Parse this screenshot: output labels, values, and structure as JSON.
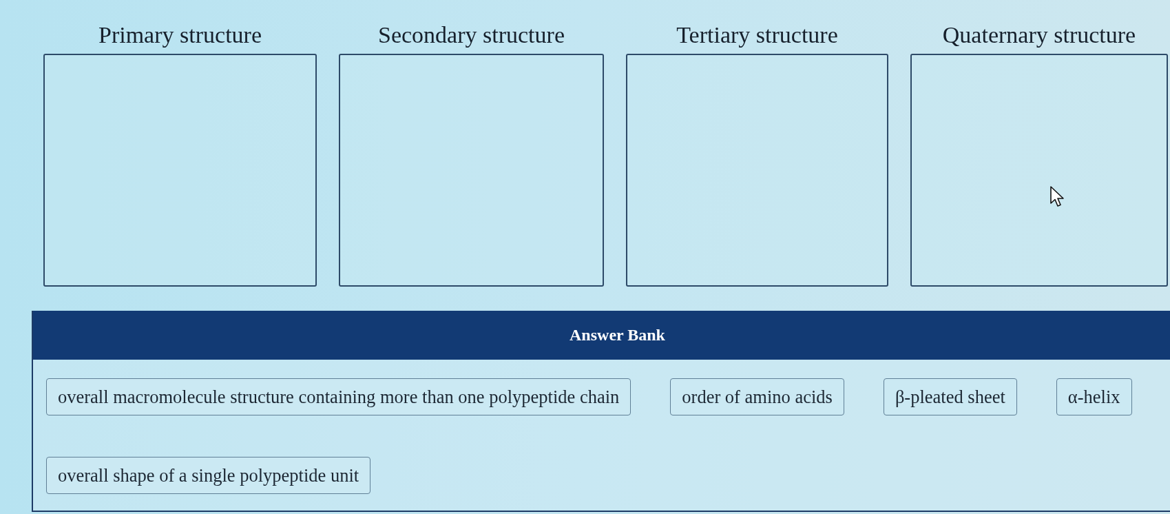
{
  "zones": [
    {
      "label": "Primary structure"
    },
    {
      "label": "Secondary structure"
    },
    {
      "label": "Tertiary structure"
    },
    {
      "label": "Quaternary structure"
    }
  ],
  "answer_bank": {
    "title": "Answer Bank",
    "items": [
      "overall macromolecule structure containing more than one polypeptide chain",
      "order of amino acids",
      "β-pleated sheet",
      "α-helix",
      "overall shape of a single polypeptide unit"
    ]
  }
}
